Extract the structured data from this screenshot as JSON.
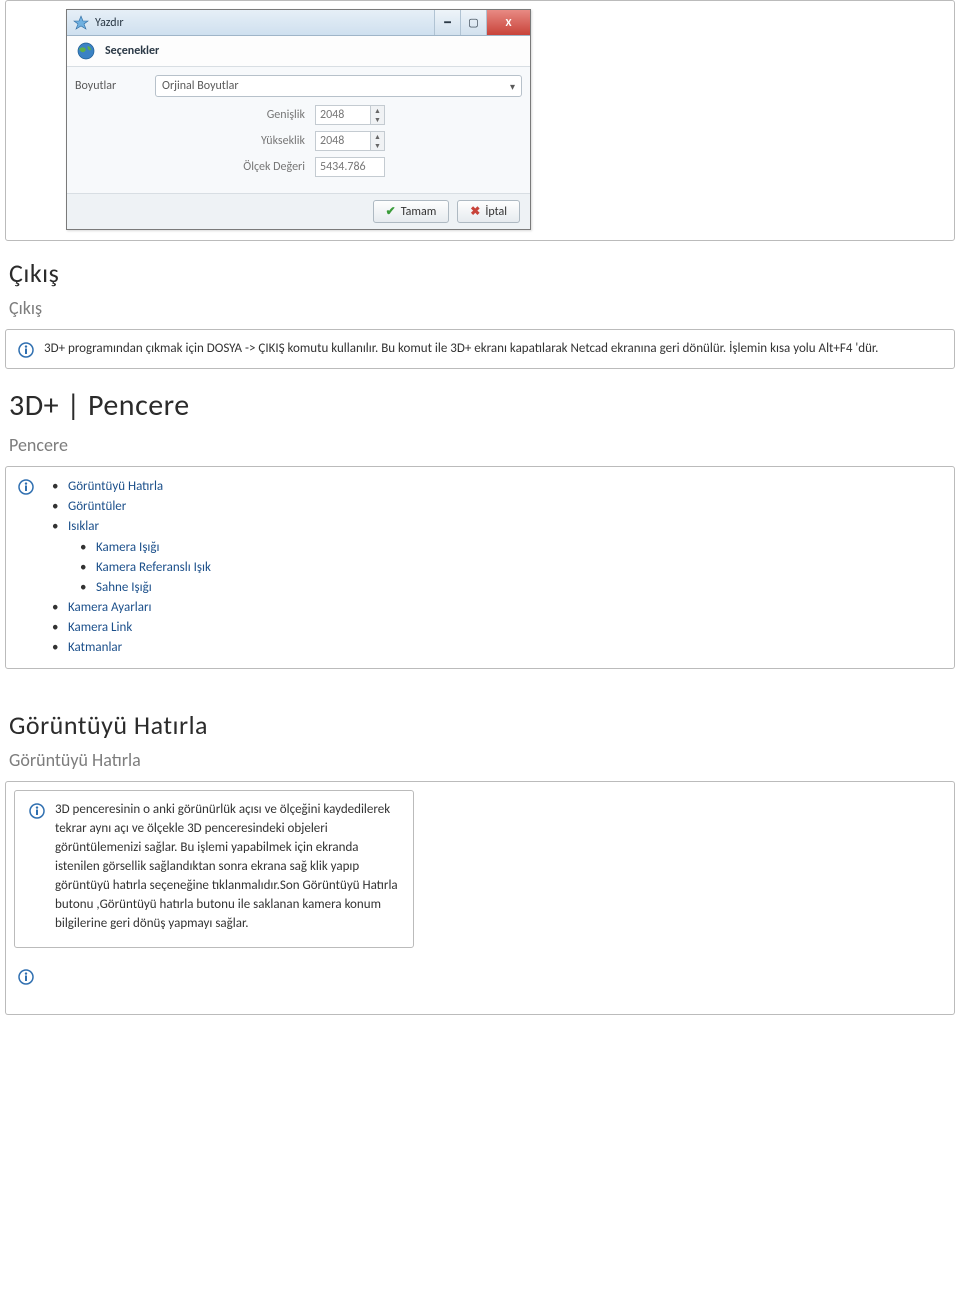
{
  "dialog": {
    "title": "Yazdır",
    "section": "Seçenekler",
    "boyutlar_label": "Boyutlar",
    "boyutlar_value": "Orjinal Boyutlar",
    "genislik_label": "Genişlik",
    "genislik_value": "2048",
    "yukseklik_label": "Yükseklik",
    "yukseklik_value": "2048",
    "olcek_label": "Ölçek Değeri",
    "olcek_value": "5434.786",
    "ok": "Tamam",
    "cancel": "İptal"
  },
  "cikis": {
    "h2": "Çıkış",
    "h3": "Çıkış",
    "text": "3D+ programından çıkmak için DOSYA -> ÇIKIŞ komutu kullanılır. Bu komut ile 3D+ ekranı kapatılarak Netcad ekranına geri dönülür. İşlemin kısa yolu Alt+F4 'dür."
  },
  "pencere": {
    "h1": "3D+ | Pencere",
    "h3": "Pencere",
    "items": {
      "i0": "Görüntüyü Hatırla",
      "i1": "Görüntüler",
      "i2": "Isıklar",
      "i2a": "Kamera Işığı",
      "i2b": "Kamera Referanslı Işık",
      "i2c": "Sahne Işığı",
      "i3": "Kamera Ayarları",
      "i4": "Kamera Link",
      "i5": "Katmanlar"
    }
  },
  "hatirla": {
    "h2": "Görüntüyü Hatırla",
    "h3": "Görüntüyü Hatırla",
    "text": "3D penceresinin o anki görünürlük açısı ve ölçeğini kaydedilerek tekrar aynı açı ve ölçekle 3D penceresindeki objeleri görüntülemenizi sağlar. Bu işlemi yapabilmek için ekranda istenilen görsellik sağlandıktan sonra ekrana sağ klik yapıp görüntüyü hatırla seçeneğine tıklanmalıdır.Son Görüntüyü Hatırla butonu ,Görüntüyü hatırla butonu ile saklanan kamera konum bilgilerine geri dönüş yapmayı sağlar."
  }
}
